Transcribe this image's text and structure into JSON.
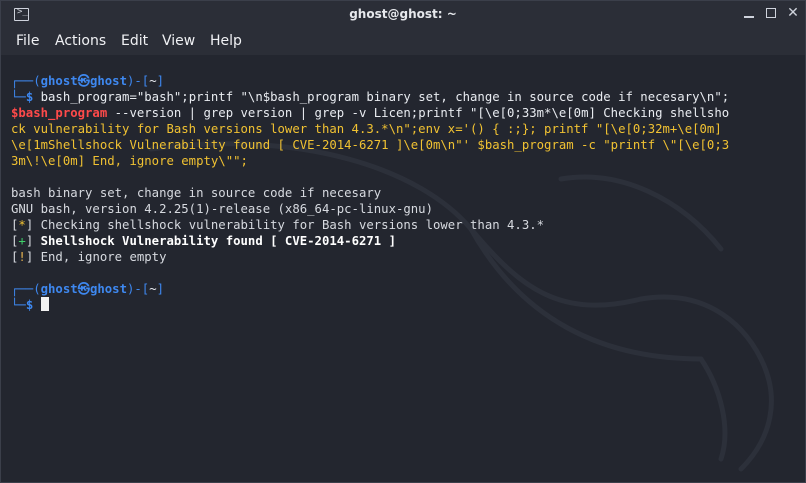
{
  "window": {
    "title": "ghost@ghost: ~",
    "icon": "terminal-icon",
    "buttons": [
      "minimize-icon",
      "maximize-icon",
      "close-icon"
    ]
  },
  "menu": {
    "file": "File",
    "actions": "Actions",
    "edit": "Edit",
    "view": "View",
    "help": "Help"
  },
  "prompt": {
    "corner_top": "┌──(",
    "user": "ghost",
    "sep": "㉿",
    "host": "ghost",
    "close_paren": ")-[",
    "dir": "~",
    "close_bracket": "]",
    "corner_bottom": "└─",
    "symbol": "$"
  },
  "command": {
    "line1": " bash_program=\"bash\";printf \"\\n$bash_program binary set, change in source code if necesary\\n\";",
    "line2_var": "$bash_program",
    "line2_rest": " --version | grep version | grep -v Licen;printf \"[\\e[0;33m*\\e[0m] Checking shellsho",
    "line3": "ck vulnerability for Bash versions lower than 4.3.*\\n\";env x='() { :;}; printf \"[\\e[0;32m+\\e[0m]",
    "line4": "\\e[1mShellshock Vulnerability found [ CVE-2014-6271 ]\\e[0m\\n\"' $bash_program -c \"printf \\\"[\\e[0;3",
    "line5": "3m\\!\\e[0m] End, ignore empty\\\"\";"
  },
  "output": {
    "line1": "bash binary set, change in source code if necesary",
    "line2": "GNU bash, version 4.2.25(1)-release (x86_64-pc-linux-gnu)",
    "line3_mark": "*",
    "line3": " Checking shellshock vulnerability for Bash versions lower than 4.3.*",
    "line4_mark": "+",
    "line4": " Shellshock Vulnerability found [ CVE-2014-6271 ]",
    "line5_mark": "!",
    "line5": " End, ignore empty"
  }
}
